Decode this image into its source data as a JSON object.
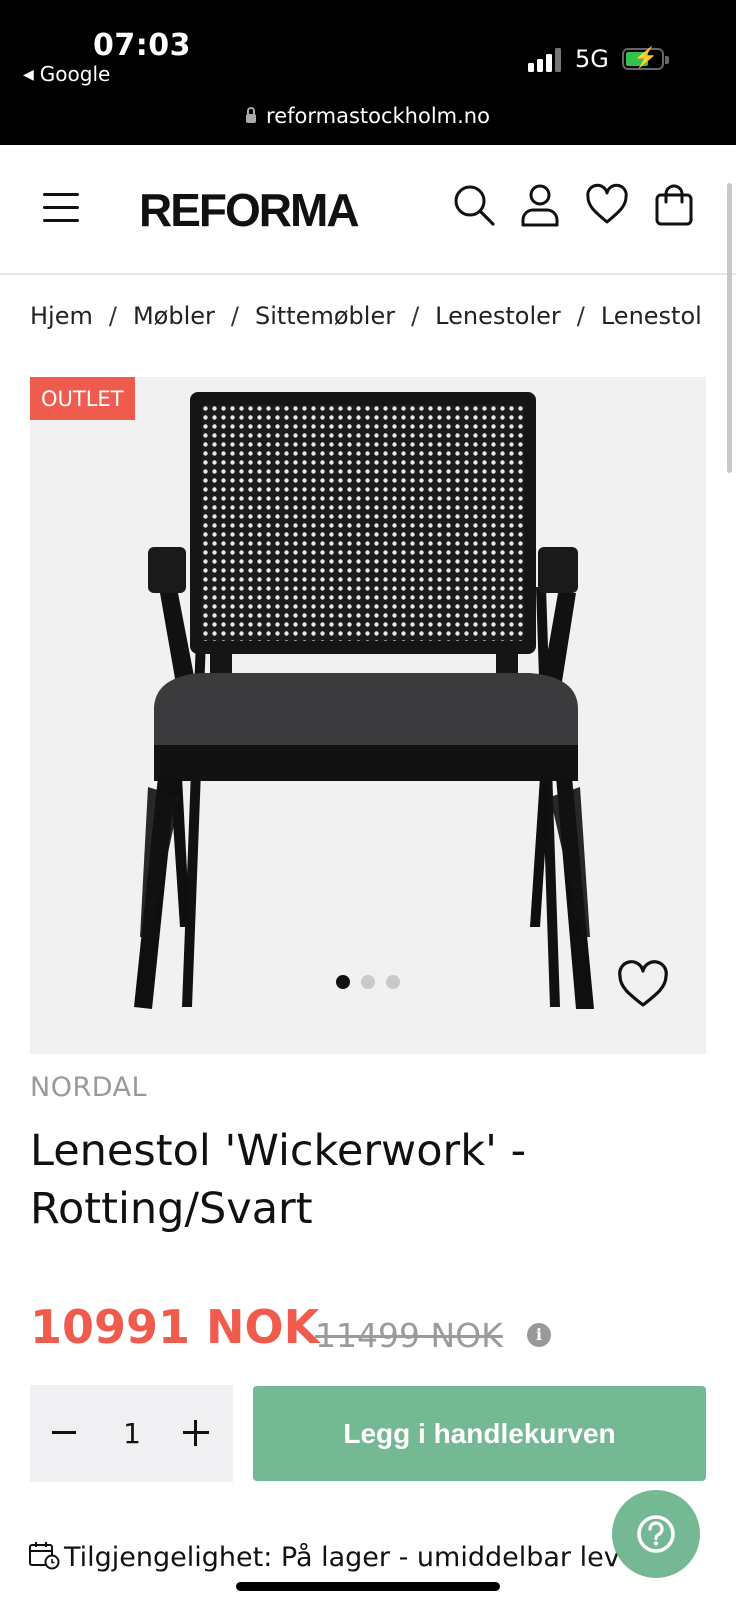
{
  "status_bar": {
    "time": "07:03",
    "back_app": "Google",
    "network": "5G",
    "url": "reformastockholm.no"
  },
  "header": {
    "logo": "REFORMA",
    "icons": [
      "menu-icon",
      "search-icon",
      "account-icon",
      "heart-icon",
      "cart-icon"
    ]
  },
  "breadcrumb": {
    "items": [
      "Hjem",
      "Møbler",
      "Sittemøbler",
      "Lenestoler",
      "Lenestol 'Wickerwork'"
    ]
  },
  "product": {
    "badge": "OUTLET",
    "brand": "NORDAL",
    "title_line1": "Lenestol 'Wickerwork' -",
    "title_line2": "Rotting/Svart",
    "price": "10991 NOK",
    "old_price": "11499 NOK",
    "image_dots": {
      "total": 3,
      "active": 1
    }
  },
  "cart": {
    "quantity": "1",
    "add_label": "Legg i handlekurven"
  },
  "availability": "Tilgjengelighet: På lager - umiddelbar lev",
  "colors": {
    "accent_green": "#74b894",
    "sale_red": "#ef5b4d"
  }
}
